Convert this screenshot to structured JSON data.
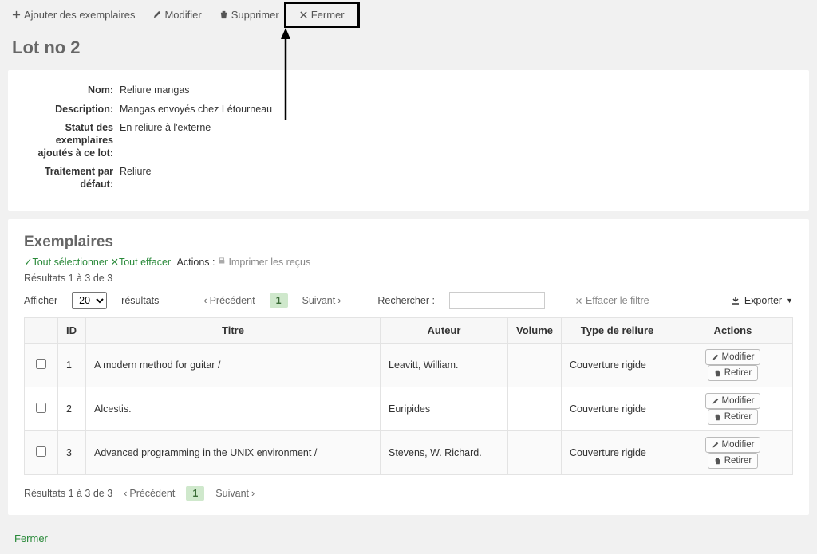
{
  "toolbar": {
    "add": "Ajouter des exemplaires",
    "edit": "Modifier",
    "delete": "Supprimer",
    "close": "Fermer"
  },
  "page_title": "Lot no 2",
  "details": {
    "name_label": "Nom:",
    "name_value": "Reliure mangas",
    "desc_label": "Description:",
    "desc_value": "Mangas envoyés chez Létourneau",
    "status_label": "Statut des exemplaires ajoutés à ce lot:",
    "status_value": "En reliure à l'externe",
    "treatment_label": "Traitement par défaut:",
    "treatment_value": "Reliure"
  },
  "items": {
    "section_title": "Exemplaires",
    "select_all": "Tout sélectionner",
    "clear_all": "Tout effacer",
    "actions_label": "Actions :",
    "print_receipts": "Imprimer les reçus",
    "results_text": "Résultats 1 à 3 de 3",
    "show_label": "Afficher",
    "show_value": "20",
    "results_label": "résultats",
    "prev": "Précédent",
    "current_page": "1",
    "next": "Suivant",
    "search_label": "Rechercher :",
    "clear_filter": "Effacer le filtre",
    "export": "Exporter",
    "columns": {
      "id": "ID",
      "title": "Titre",
      "author": "Auteur",
      "volume": "Volume",
      "binding": "Type de reliure",
      "actions": "Actions"
    },
    "rows": [
      {
        "id": "1",
        "title": "A modern method for guitar /",
        "author": "Leavitt, William.",
        "volume": "",
        "binding": "Couverture rigide"
      },
      {
        "id": "2",
        "title": "Alcestis.",
        "author": "Euripides",
        "volume": "",
        "binding": "Couverture rigide"
      },
      {
        "id": "3",
        "title": "Advanced programming in the UNIX environment /",
        "author": "Stevens, W. Richard.",
        "volume": "",
        "binding": "Couverture rigide"
      }
    ],
    "row_edit": "Modifier",
    "row_remove": "Retirer"
  },
  "footer": {
    "close": "Fermer"
  }
}
